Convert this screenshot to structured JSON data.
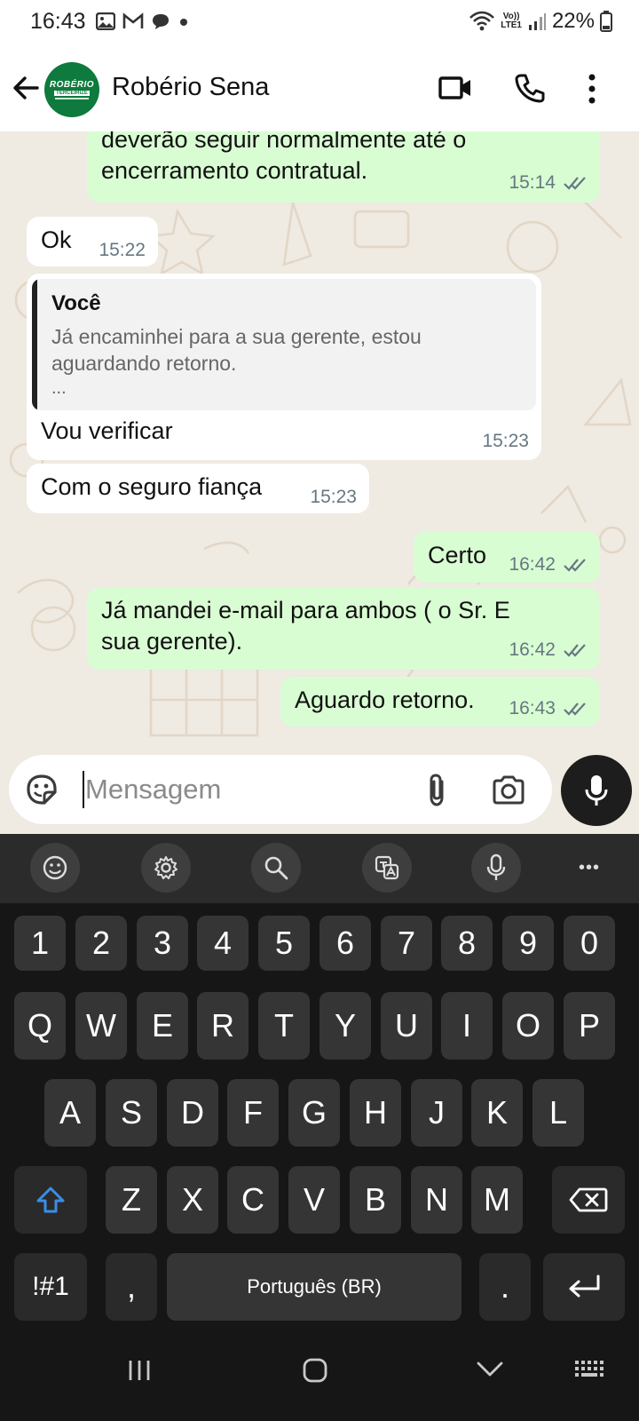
{
  "status_bar": {
    "time": "16:43",
    "network_label_top": "Vo))",
    "network_label_bottom": "LTE1",
    "battery": "22%"
  },
  "header": {
    "contact_name": "Robério Sena",
    "avatar_line1": "ROBÉRIO",
    "avatar_line2": "TERCEIRIZE"
  },
  "messages": [
    {
      "direction": "out",
      "lines": [
        "deverão seguir normalmente até  o",
        "encerramento contratual."
      ],
      "time": "15:14",
      "status": "read"
    },
    {
      "direction": "in",
      "lines": [
        "Ok"
      ],
      "time": "15:22"
    },
    {
      "direction": "in",
      "quote": {
        "author": "Você",
        "lines": [
          "Já  encaminhei para a sua gerente, estou",
          "aguardando  retorno."
        ],
        "more": "..."
      },
      "lines": [
        "Vou verificar"
      ],
      "time": "15:23"
    },
    {
      "direction": "in",
      "lines": [
        "Com o seguro fiança"
      ],
      "time": "15:23"
    },
    {
      "direction": "out",
      "lines": [
        "Certo"
      ],
      "time": "16:42",
      "status": "read"
    },
    {
      "direction": "out",
      "lines": [
        "Já mandei e-mail para ambos ( o Sr. E",
        "sua gerente)."
      ],
      "time": "16:42",
      "status": "read"
    },
    {
      "direction": "out",
      "lines": [
        "Aguardo retorno."
      ],
      "time": "16:43",
      "status": "read"
    }
  ],
  "composer": {
    "placeholder": "Mensagem",
    "value": ""
  },
  "keyboard": {
    "row_numbers": [
      "1",
      "2",
      "3",
      "4",
      "5",
      "6",
      "7",
      "8",
      "9",
      "0"
    ],
    "row_1": [
      "Q",
      "W",
      "E",
      "R",
      "T",
      "Y",
      "U",
      "I",
      "O",
      "P"
    ],
    "row_2": [
      "A",
      "S",
      "D",
      "F",
      "G",
      "H",
      "J",
      "K",
      "L"
    ],
    "row_3": [
      "Z",
      "X",
      "C",
      "V",
      "B",
      "N",
      "M"
    ],
    "symbols_key": "!#1",
    "comma_key": ",",
    "space_label": "Português (BR)",
    "period_key": ".",
    "more_label": "•••"
  },
  "icons": {
    "status_left": [
      "gallery-icon",
      "gmail-icon",
      "chat-bubble-icon",
      "dot-icon"
    ],
    "status_right": [
      "wifi-icon",
      "signal-icon",
      "battery-icon"
    ],
    "header": [
      "back-arrow-icon",
      "video-call-icon",
      "phone-icon",
      "more-vert-icon"
    ],
    "composer": [
      "sticker-icon",
      "attach-icon",
      "camera-icon",
      "mic-icon"
    ],
    "kb_toolbar": [
      "emoji-icon",
      "settings-icon",
      "search-icon",
      "translate-icon",
      "voice-input-icon",
      "more-icon"
    ]
  },
  "colors": {
    "outgoing_bubble": "#d9fdd3",
    "incoming_bubble": "#ffffff",
    "chat_background": "#efeae2",
    "read_ticks": "#667781",
    "shift_accent": "#3b8de8",
    "avatar_green": "#0e7a3d"
  }
}
